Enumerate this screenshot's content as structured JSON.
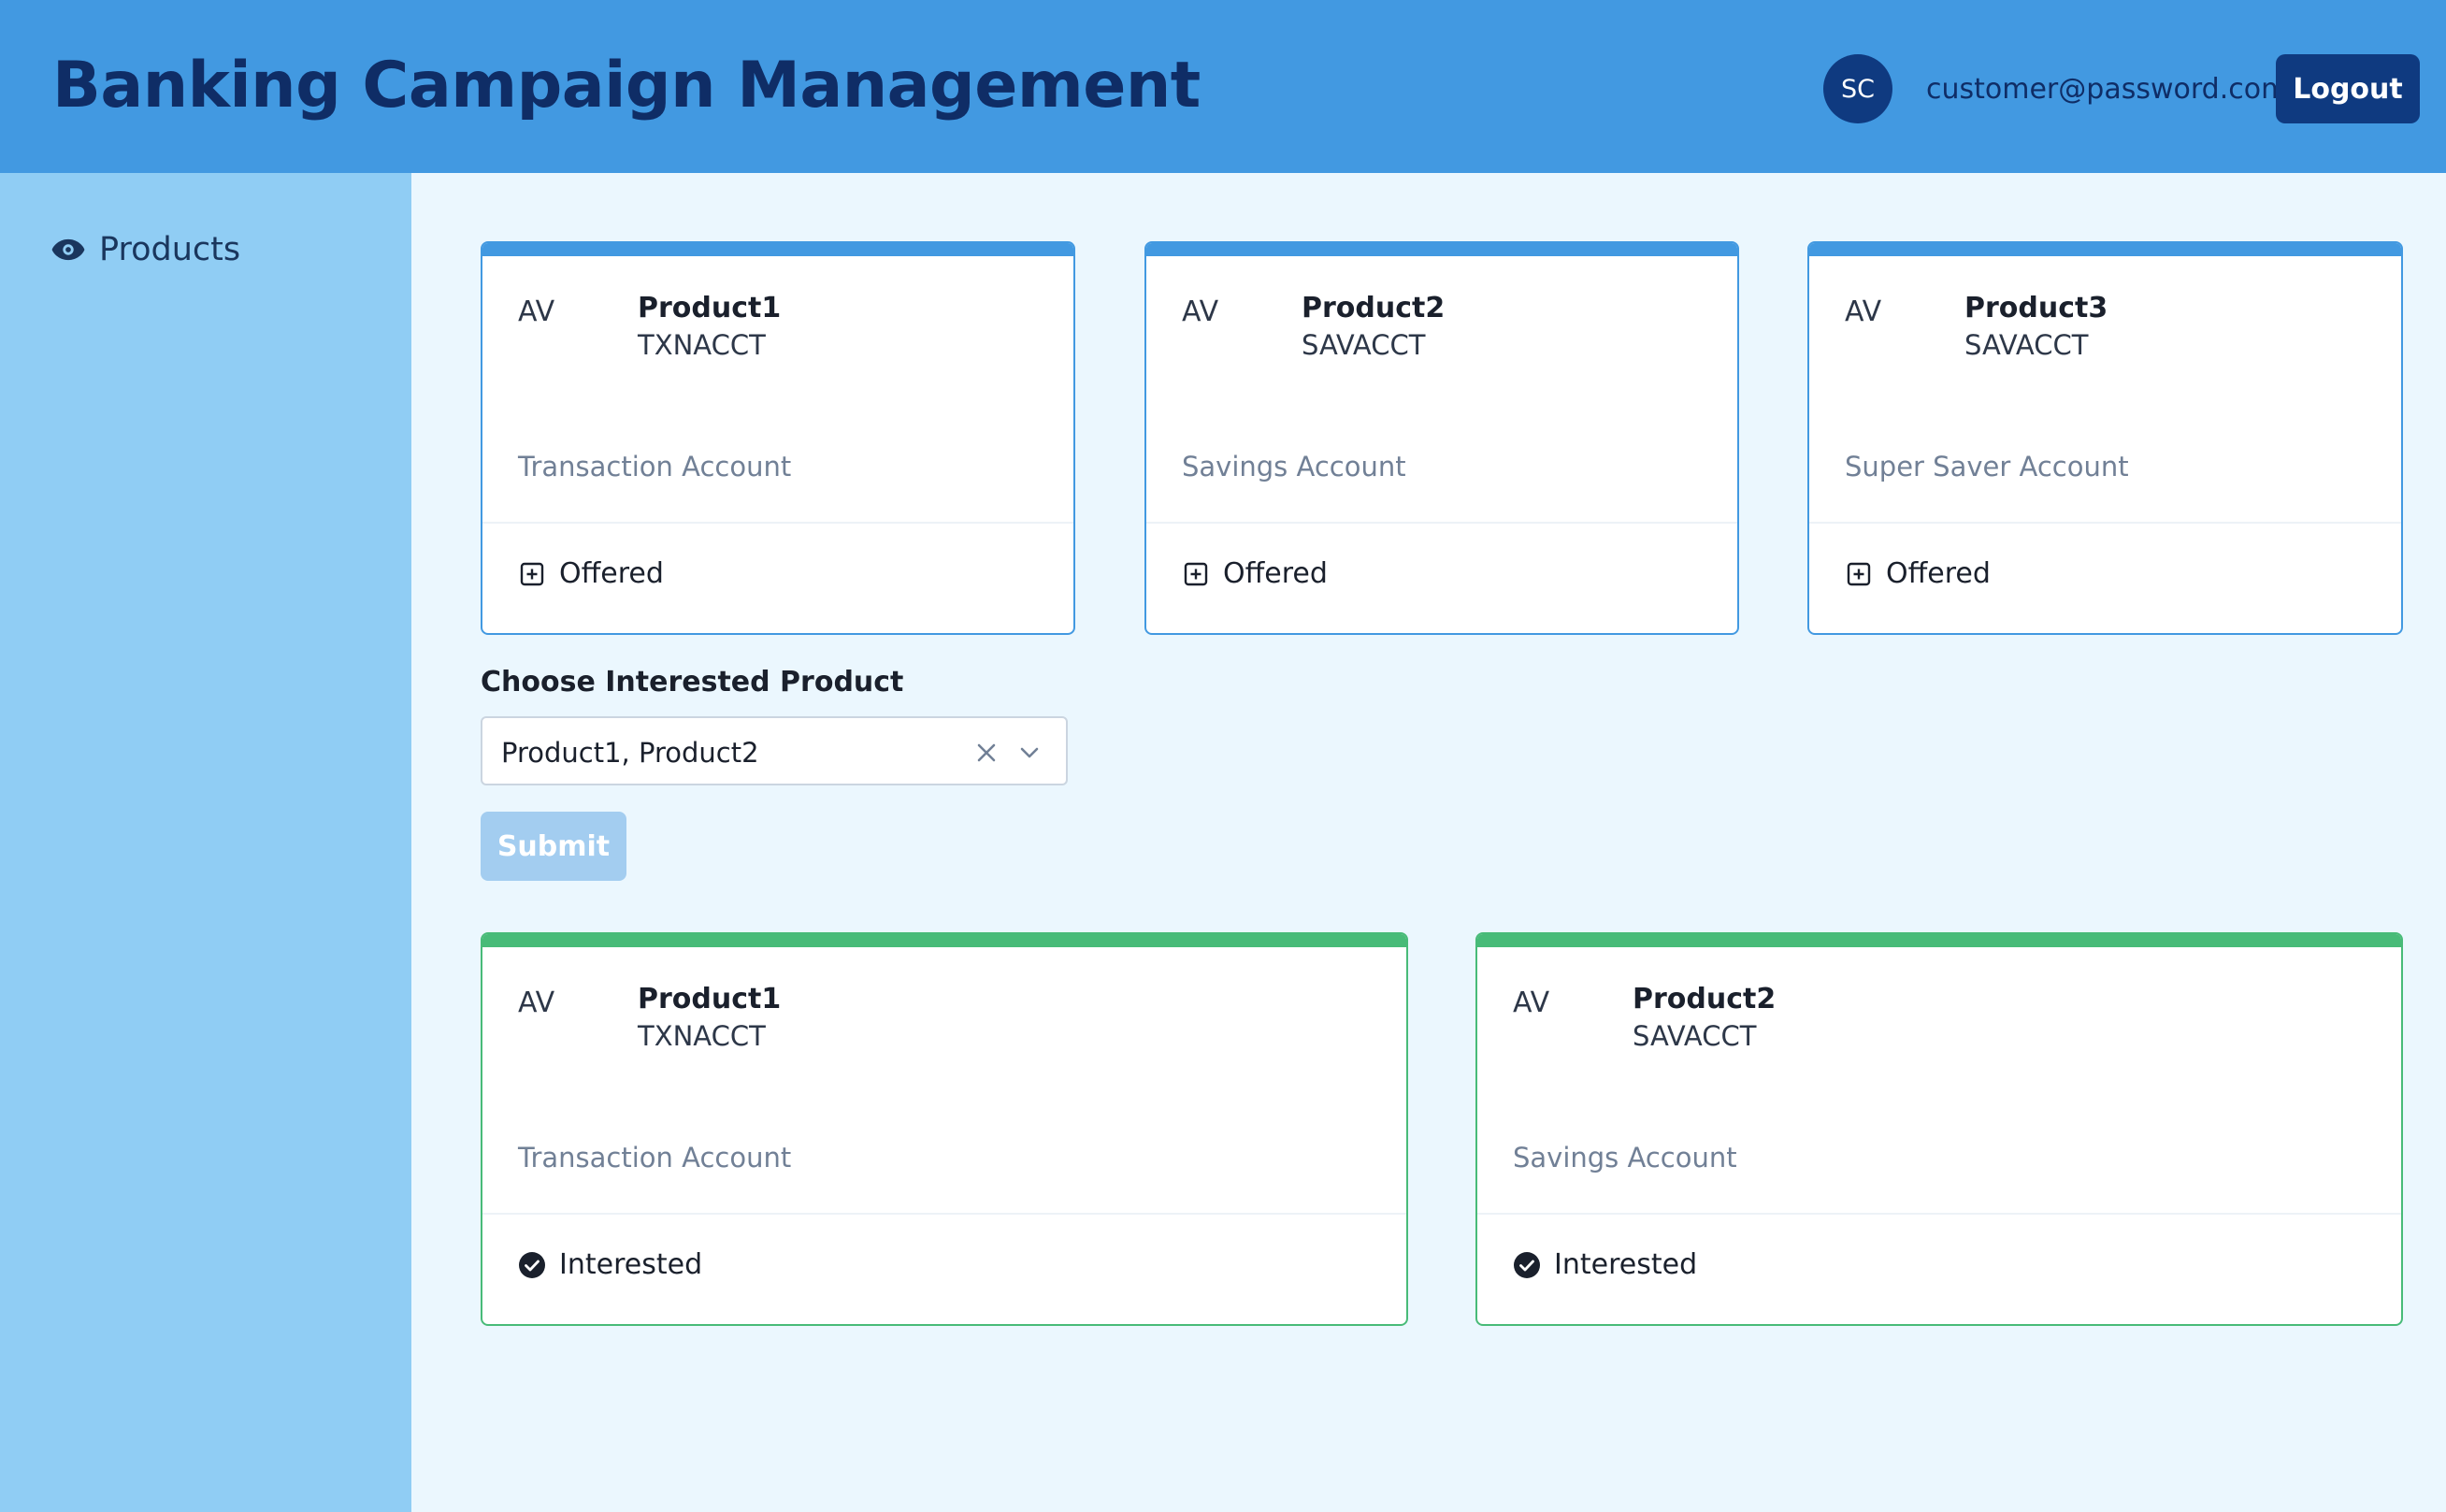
{
  "header": {
    "title": "Banking Campaign Management",
    "avatar_initials": "SC",
    "user_email": "customer@password.com",
    "logout_label": "Logout"
  },
  "sidebar": {
    "items": [
      {
        "label": "Products",
        "icon": "eye-icon"
      }
    ]
  },
  "offered_products": [
    {
      "abbr": "AV",
      "name": "Product1",
      "code": "TXNACCT",
      "description": "Transaction Account",
      "status": "Offered",
      "status_icon": "plus-square-icon"
    },
    {
      "abbr": "AV",
      "name": "Product2",
      "code": "SAVACCT",
      "description": "Savings Account",
      "status": "Offered",
      "status_icon": "plus-square-icon"
    },
    {
      "abbr": "AV",
      "name": "Product3",
      "code": "SAVACCT",
      "description": "Super Saver Account",
      "status": "Offered",
      "status_icon": "plus-square-icon"
    }
  ],
  "form": {
    "label": "Choose Interested Product",
    "selected_value": "Product1, Product2",
    "submit_label": "Submit"
  },
  "interested_products": [
    {
      "abbr": "AV",
      "name": "Product1",
      "code": "TXNACCT",
      "description": "Transaction Account",
      "status": "Interested",
      "status_icon": "check-circle-icon"
    },
    {
      "abbr": "AV",
      "name": "Product2",
      "code": "SAVACCT",
      "description": "Savings Account",
      "status": "Interested",
      "status_icon": "check-circle-icon"
    }
  ],
  "colors": {
    "header_bg": "#4299e1",
    "sidebar_bg": "#90cdf4",
    "offered_accent": "#4299e1",
    "interested_accent": "#48bb78",
    "primary_dark": "#0f3a80"
  }
}
